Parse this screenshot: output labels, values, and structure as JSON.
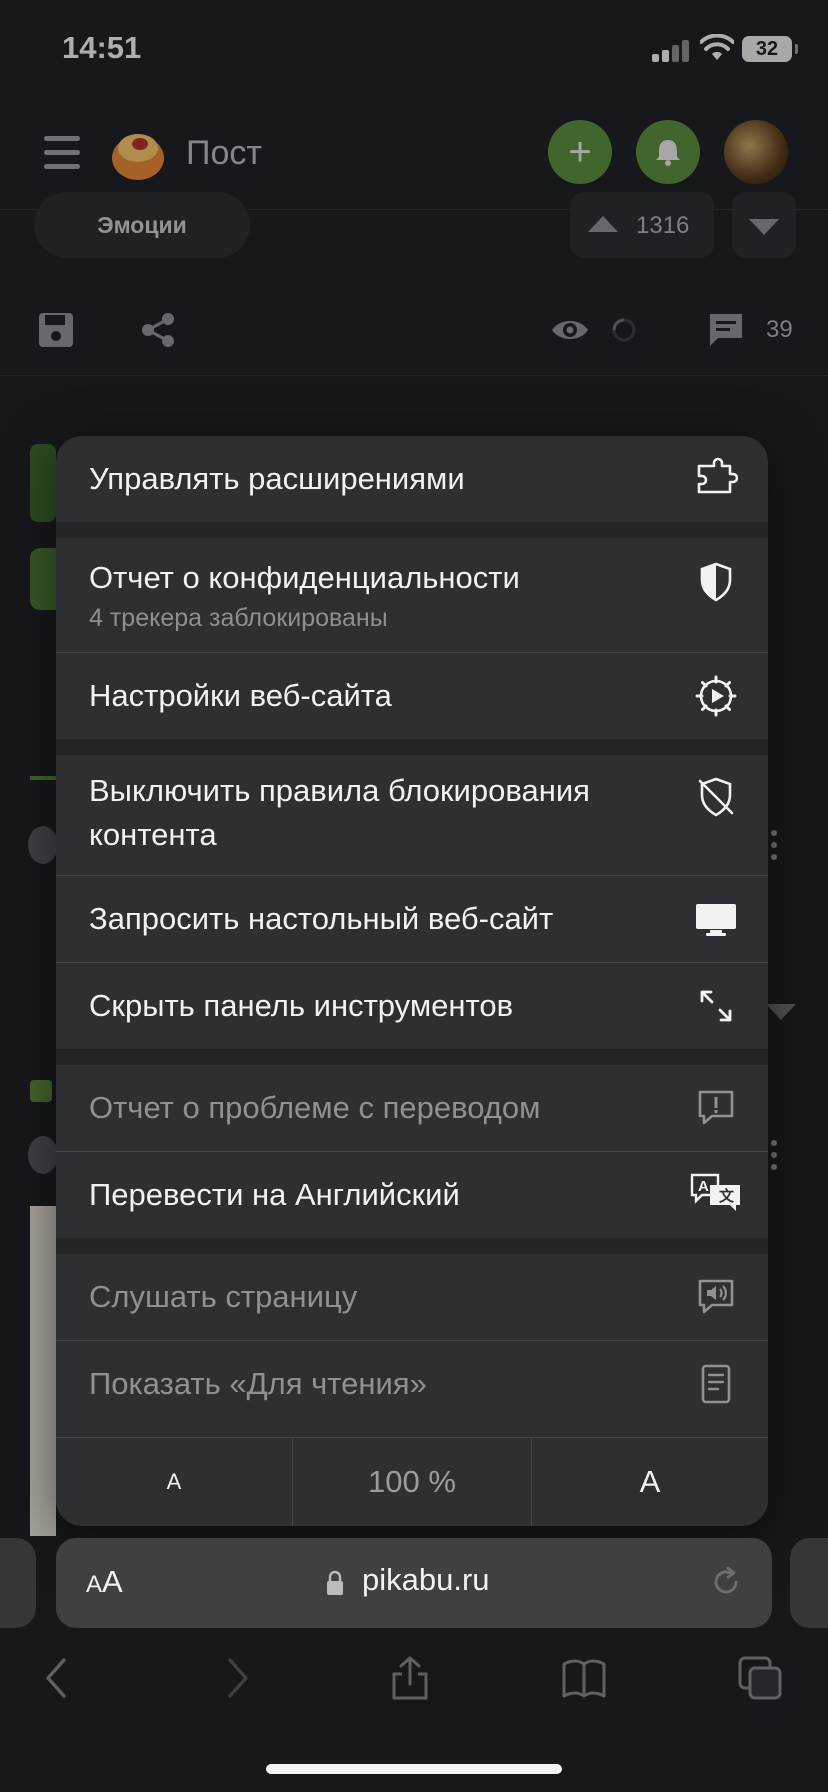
{
  "status_bar": {
    "time": "14:51",
    "battery": "32"
  },
  "header": {
    "title": "Пост"
  },
  "post": {
    "tag": "Эмоции",
    "rating": "1316",
    "comments": "39"
  },
  "menu": {
    "items": [
      {
        "label": "Управлять расширениями",
        "icon": "extension-puzzle-icon"
      },
      {
        "label": "Отчет о конфиденциальности",
        "sub": "4 трекера заблокированы",
        "icon": "privacy-shield-icon"
      },
      {
        "label": "Настройки веб-сайта",
        "icon": "website-settings-gear-icon"
      },
      {
        "label_line1": "Выключить правила блокирования",
        "label_line2": "контента",
        "icon": "shield-slash-icon"
      },
      {
        "label": "Запросить настольный веб-сайт",
        "icon": "desktop-monitor-icon"
      },
      {
        "label": "Скрыть панель инструментов",
        "icon": "expand-arrows-icon"
      },
      {
        "label": "Отчет о проблеме с переводом",
        "icon": "report-bubble-icon",
        "disabled": true
      },
      {
        "label": "Перевести на Английский",
        "icon": "translate-icon"
      },
      {
        "label": "Слушать страницу",
        "icon": "speaker-bubble-icon",
        "disabled": true
      },
      {
        "label": "Показать «Для чтения»",
        "icon": "reader-icon",
        "disabled": true
      }
    ],
    "zoom": {
      "smaller": "A",
      "level": "100 %",
      "larger": "A"
    }
  },
  "address_bar": {
    "aa": "AA",
    "url": "pikabu.ru"
  },
  "colors": {
    "accent_green": "#5c8b3f",
    "menu_bg": "#2d2f32"
  }
}
